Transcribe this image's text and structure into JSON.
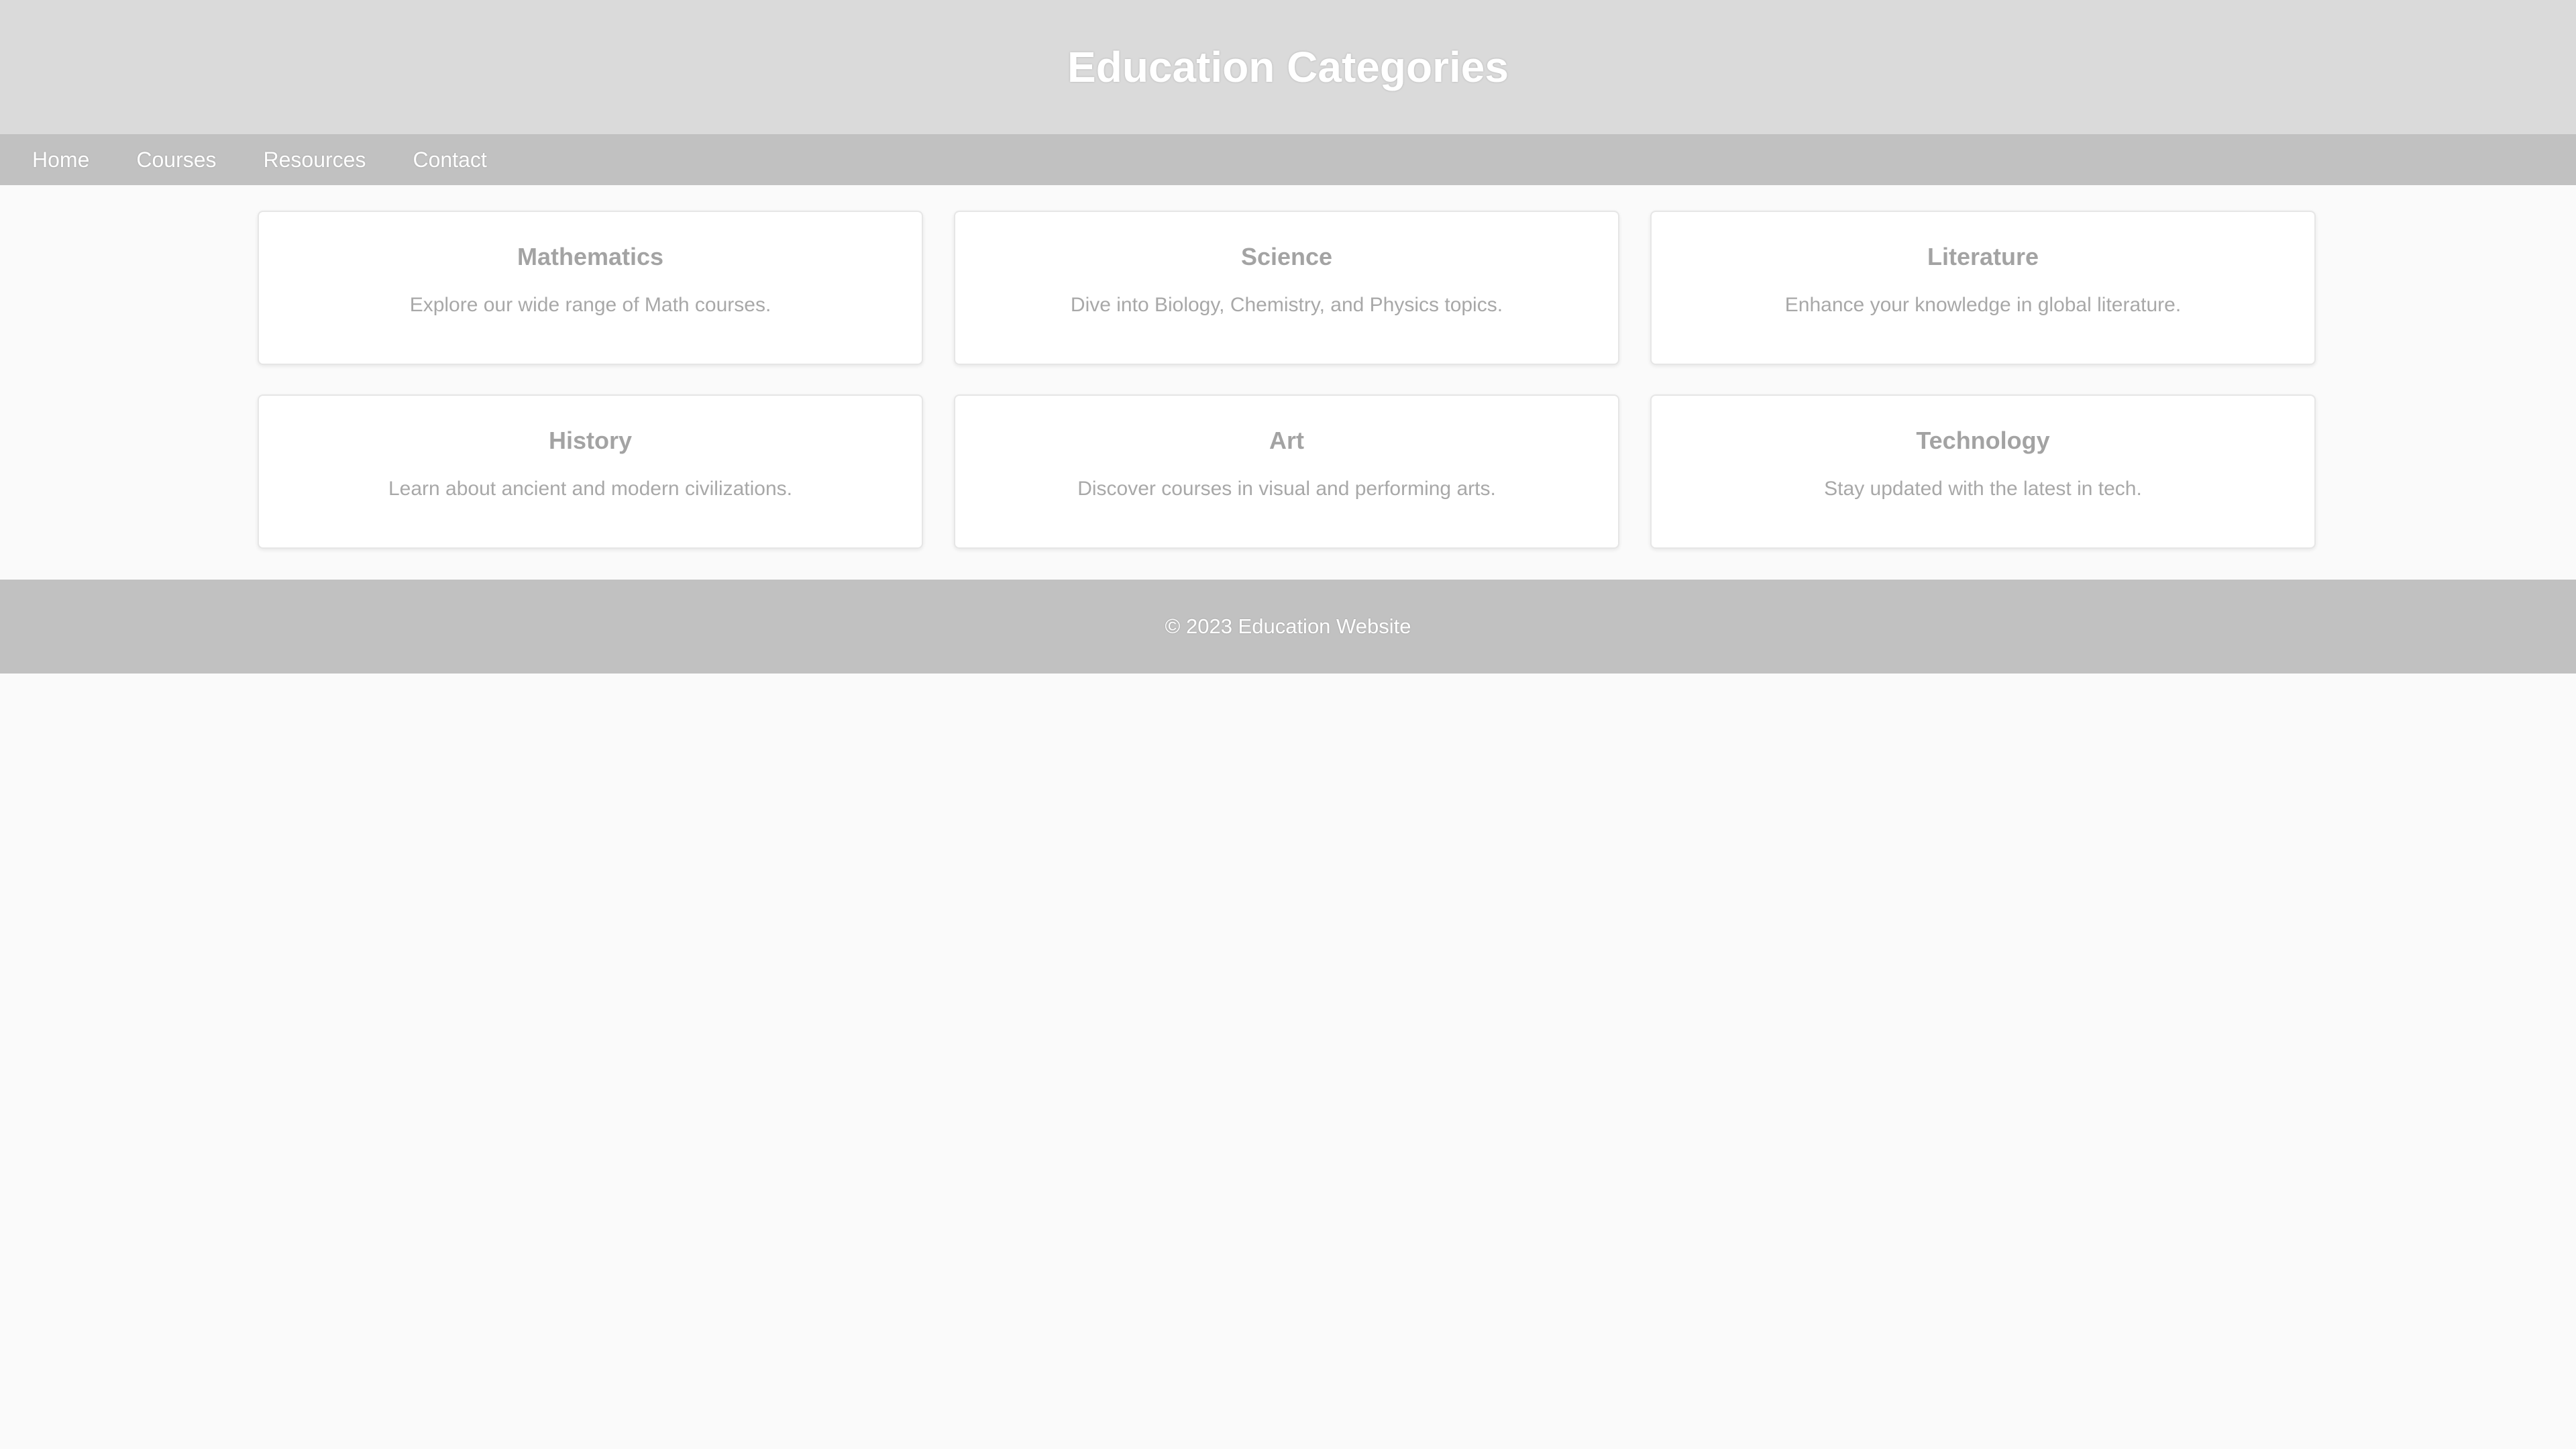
{
  "header": {
    "title": "Education Categories"
  },
  "nav": {
    "items": [
      {
        "label": "Home"
      },
      {
        "label": "Courses"
      },
      {
        "label": "Resources"
      },
      {
        "label": "Contact"
      }
    ]
  },
  "categories": [
    {
      "title": "Mathematics",
      "description": "Explore our wide range of Math courses."
    },
    {
      "title": "Science",
      "description": "Dive into Biology, Chemistry, and Physics topics."
    },
    {
      "title": "Literature",
      "description": "Enhance your knowledge in global literature."
    },
    {
      "title": "History",
      "description": "Learn about ancient and modern civilizations."
    },
    {
      "title": "Art",
      "description": "Discover courses in visual and performing arts."
    },
    {
      "title": "Technology",
      "description": "Stay updated with the latest in tech."
    }
  ],
  "footer": {
    "text": "© 2023 Education Website"
  },
  "colors": {
    "header_bg": "#dadada",
    "nav_bg": "#c1c1c1",
    "page_bg": "#fafafa",
    "card_bg": "#ffffff",
    "card_title": "#a3a3a3",
    "card_text": "#a8a8a8"
  }
}
